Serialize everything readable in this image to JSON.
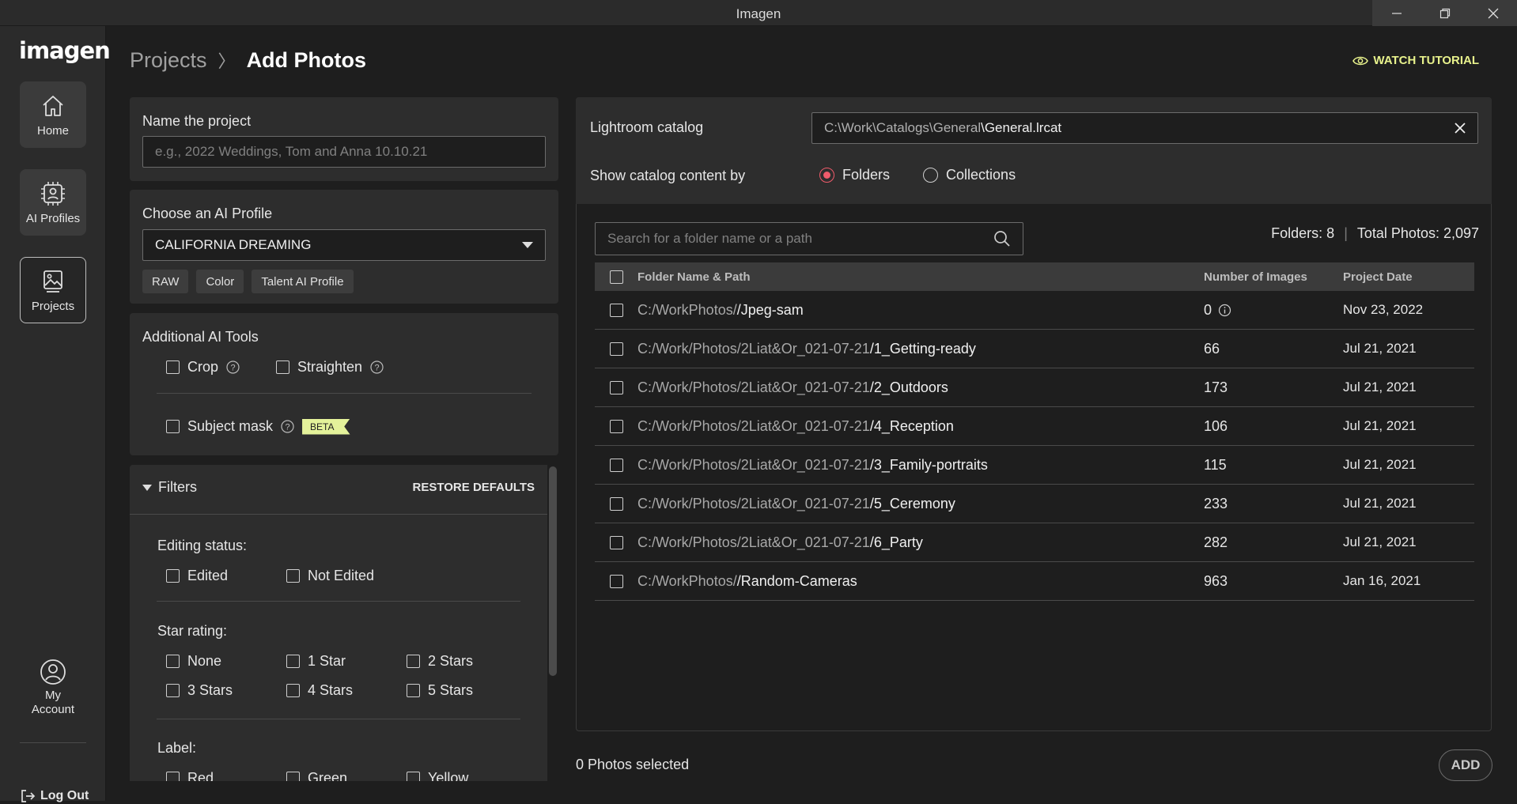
{
  "window": {
    "title": "Imagen"
  },
  "sidebar": {
    "logo": "imagen",
    "items": [
      {
        "label": "Home",
        "icon": "home-icon"
      },
      {
        "label": "AI Profiles",
        "icon": "ai-profile-icon"
      },
      {
        "label": "Projects",
        "icon": "projects-icon",
        "active": true
      }
    ],
    "account_line1": "My",
    "account_line2": "Account",
    "logout": "Log Out"
  },
  "header": {
    "breadcrumb_parent": "Projects",
    "breadcrumb_separator": "〉",
    "breadcrumb_current": "Add Photos",
    "tutorial": "WATCH TUTORIAL"
  },
  "project": {
    "name_label": "Name the project",
    "name_placeholder": "e.g., 2022 Weddings, Tom and Anna 10.10.21"
  },
  "ai_profile": {
    "label": "Choose an AI Profile",
    "selected": "CALIFORNIA DREAMING",
    "tags": [
      "RAW",
      "Color",
      "Talent AI Profile"
    ]
  },
  "tools": {
    "label": "Additional AI Tools",
    "crop": "Crop",
    "straighten": "Straighten",
    "subject_mask": "Subject mask",
    "beta": "BETA"
  },
  "filters": {
    "title": "Filters",
    "restore": "RESTORE DEFAULTS",
    "editing_label": "Editing status:",
    "editing_options": [
      "Edited",
      "Not Edited"
    ],
    "star_label": "Star rating:",
    "star_options": [
      "None",
      "1 Star",
      "2 Stars",
      "3 Stars",
      "4 Stars",
      "5 Stars"
    ],
    "label_label": "Label:",
    "label_options": [
      "Red",
      "Green",
      "Yellow"
    ]
  },
  "catalog": {
    "label": "Lightroom catalog",
    "path_prefix": "C:\\Work\\Catalogs\\General",
    "path_file": "\\General.lrcat",
    "show_by_label": "Show catalog content by",
    "options": [
      "Folders",
      "Collections"
    ],
    "selected_option": "Folders"
  },
  "search": {
    "placeholder": "Search for a folder name or a path"
  },
  "summary": {
    "folders": "Folders: 8",
    "separator": "|",
    "total": "Total Photos: 2,097"
  },
  "table": {
    "columns": [
      "Folder Name & Path",
      "Number of Images",
      "Project Date"
    ],
    "rows": [
      {
        "path": "C:/WorkPhotos/",
        "leaf": "/Jpeg-sam",
        "count": "0",
        "info": true,
        "date": "Nov 23, 2022"
      },
      {
        "path": "C:/Work/Photos/2Liat&Or_021-07-21",
        "leaf": "/1_Getting-ready",
        "count": "66",
        "date": "Jul 21, 2021"
      },
      {
        "path": "C:/Work/Photos/2Liat&Or_021-07-21",
        "leaf": "/2_Outdoors",
        "count": "173",
        "date": "Jul 21, 2021"
      },
      {
        "path": "C:/Work/Photos/2Liat&Or_021-07-21",
        "leaf": "/4_Reception",
        "count": "106",
        "date": "Jul 21, 2021"
      },
      {
        "path": "C:/Work/Photos/2Liat&Or_021-07-21",
        "leaf": "/3_Family-portraits",
        "count": "115",
        "date": "Jul 21, 2021"
      },
      {
        "path": "C:/Work/Photos/2Liat&Or_021-07-21",
        "leaf": "/5_Ceremony",
        "count": "233",
        "date": "Jul 21, 2021"
      },
      {
        "path": "C:/Work/Photos/2Liat&Or_021-07-21",
        "leaf": "/6_Party",
        "count": "282",
        "date": "Jul 21, 2021"
      },
      {
        "path": "C:/WorkPhotos/",
        "leaf": "/Random-Cameras",
        "count": "963",
        "date": "Jan 16, 2021"
      }
    ]
  },
  "footer": {
    "selected": "0 Photos selected",
    "add": "ADD"
  },
  "colors": {
    "accent_radio": "#f05b6b",
    "tutorial": "#e8f28c",
    "beta_bg": "#e4f29a"
  }
}
